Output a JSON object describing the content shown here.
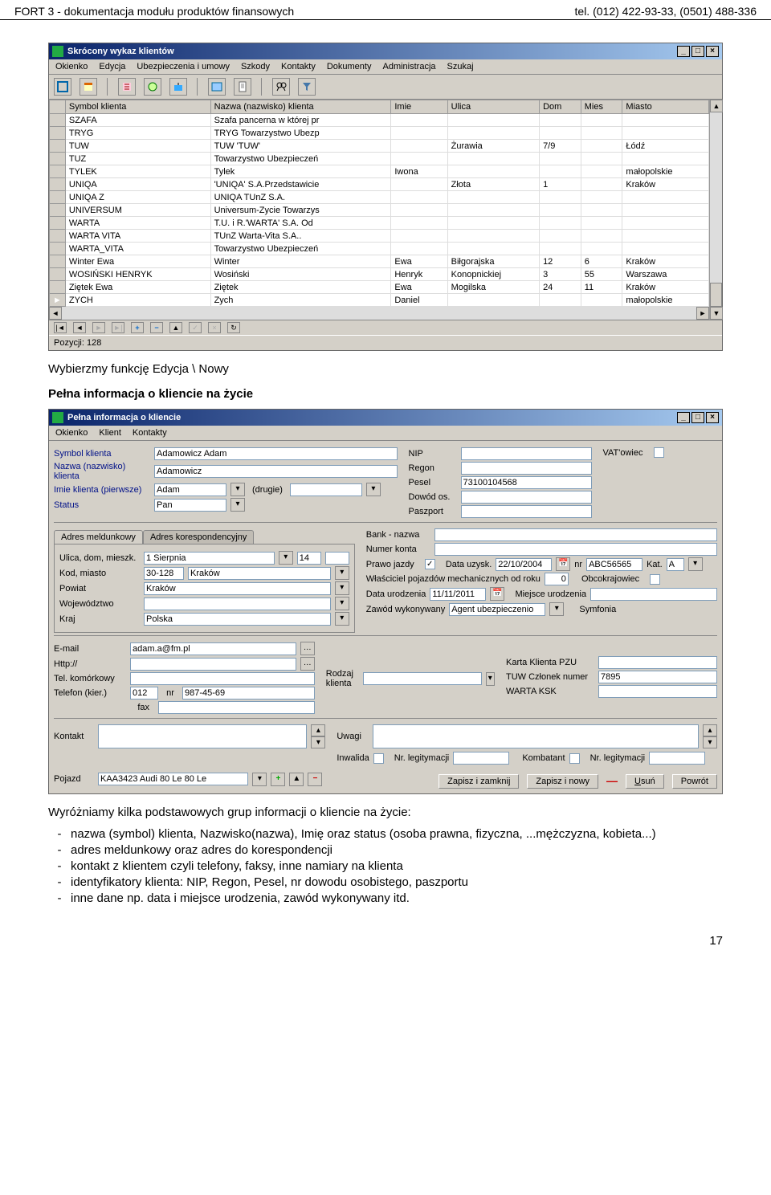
{
  "header": {
    "left": "FORT 3 - dokumentacja modułu produktów finansowych",
    "right": "tel. (012) 422-93-33, (0501) 488-336"
  },
  "win1": {
    "title": "Skrócony wykaz klientów",
    "menu": [
      "Okienko",
      "Edycja",
      "Ubezpieczenia i umowy",
      "Szkody",
      "Kontakty",
      "Dokumenty",
      "Administracja",
      "Szukaj"
    ],
    "cols": [
      "Symbol klienta",
      "Nazwa (nazwisko) klienta",
      "Imie",
      "Ulica",
      "Dom",
      "Mies",
      "Miasto"
    ],
    "rows": [
      [
        "SZAFA",
        "Szafa pancerna w której pr",
        "",
        "",
        "",
        "",
        ""
      ],
      [
        "TRYG",
        "TRYG Towarzystwo Ubezp",
        "",
        "",
        "",
        "",
        ""
      ],
      [
        "TUW",
        "TUW 'TUW'",
        "",
        "Żurawia",
        "7/9",
        "",
        "Łódź"
      ],
      [
        "TUZ",
        "Towarzystwo Ubezpieczeń",
        "",
        "",
        "",
        "",
        ""
      ],
      [
        "TYLEK",
        "Tylek",
        "Iwona",
        "",
        "",
        "",
        "małopolskie"
      ],
      [
        "UNIQA",
        "'UNIQA' S.A.Przedstawicie",
        "",
        "Złota",
        "1",
        "",
        "Kraków"
      ],
      [
        "UNIQA Z",
        "UNIQA TUnZ S.A.",
        "",
        "",
        "",
        "",
        ""
      ],
      [
        "UNIVERSUM",
        "Universum-Zycie Towarzys",
        "",
        "",
        "",
        "",
        ""
      ],
      [
        "WARTA",
        "T.U. i R.'WARTA' S.A. Od",
        "",
        "",
        "",
        "",
        ""
      ],
      [
        "WARTA VITA",
        "TUnZ Warta-Vita S.A..",
        "",
        "",
        "",
        "",
        ""
      ],
      [
        "WARTA_VITA",
        "Towarzystwo Ubezpieczeń",
        "",
        "",
        "",
        "",
        ""
      ],
      [
        "Winter Ewa",
        "Winter",
        "Ewa",
        "Biłgorajska",
        "12",
        "6",
        "Kraków"
      ],
      [
        "WOSIŃSKI HENRYK",
        "Wosiński",
        "Henryk",
        "Konopnickiej",
        "3",
        "55",
        "Warszawa"
      ],
      [
        "Ziętek Ewa",
        "Ziętek",
        "Ewa",
        "Mogilska",
        "24",
        "11",
        "Kraków"
      ],
      [
        "ZYCH",
        "Zych",
        "Daniel",
        "",
        "",
        "",
        "małopolskie"
      ]
    ],
    "status": "Pozycji: 128"
  },
  "para1": "Wybierzmy funkcję Edycja \\ Nowy",
  "para2": "Pełna informacja o kliencie na życie",
  "win2": {
    "title": "Pełna informacja o kliencie",
    "menu": [
      "Okienko",
      "Klient",
      "Kontakty"
    ],
    "labels": {
      "symbol": "Symbol klienta",
      "nazwa": "Nazwa (nazwisko) klienta",
      "imie1": "Imie klienta (pierwsze)",
      "drugie": "(drugie)",
      "status": "Status",
      "nip": "NIP",
      "regon": "Regon",
      "pesel": "Pesel",
      "dowod": "Dowód os.",
      "paszport": "Paszport",
      "vat": "VAT'owiec",
      "tab1": "Adres meldunkowy",
      "tab2": "Adres korespondencyjny",
      "ulica": "Ulica, dom, mieszk.",
      "kod": "Kod, miasto",
      "powiat": "Powiat",
      "woj": "Województwo",
      "kraj": "Kraj",
      "bank": "Bank - nazwa",
      "numer": "Numer konta",
      "prawo": "Prawo jazdy",
      "datau": "Data uzysk.",
      "nr": "nr",
      "kat": "Kat.",
      "wlasc": "Właściciel pojazdów mechanicznych od roku",
      "obco": "Obcokrajowiec",
      "datur": "Data urodzenia",
      "miejur": "Miejsce urodzenia",
      "zawod": "Zawód wykonywany",
      "symf": "Symfonia",
      "email": "E-mail",
      "http": "Http://",
      "telkom": "Tel. komórkowy",
      "telkier": "Telefon (kier.)",
      "nr2": "nr",
      "fax": "fax",
      "rodzaj": "Rodzaj klienta",
      "kpzu": "Karta Klienta PZU",
      "tuwn": "TUW Członek numer",
      "warta": "WARTA KSK",
      "kontakt": "Kontakt",
      "uwagi": "Uwagi",
      "inwalida": "Inwalida",
      "nleg1": "Nr. legitymacji",
      "kombat": "Kombatant",
      "nleg2": "Nr. legitymacji",
      "pojazd": "Pojazd"
    },
    "values": {
      "symbol": "Adamowicz Adam",
      "nazwa": "Adamowicz",
      "imie1": "Adam",
      "status": "Pan",
      "pesel": "73100104568",
      "ulica": "1 Sierpnia",
      "dom": "14",
      "kod": "30-128",
      "miasto": "Kraków",
      "powiat": "Kraków",
      "kraj": "Polska",
      "datau": "22/10/2004",
      "nrpj": "ABC56565",
      "kat": "A",
      "wlascrok": "0",
      "datur": "11/11/2011",
      "zawod": "Agent ubezpieczenio",
      "email": "adam.a@fm.pl",
      "telkier": "012",
      "telnr": "987-45-69",
      "tuwn": "7895",
      "pojazd": "KAA3423 Audi 80 Le 80 Le"
    },
    "buttons": {
      "zapzam": "Zapisz i zamknij",
      "zapnowy": "Zapisz i nowy",
      "usun": "Usuń",
      "powrot": "Powrót"
    }
  },
  "para3": "Wyróżniamy kilka podstawowych grup informacji o kliencie na życie:",
  "bullets": [
    "nazwa (symbol) klienta, Nazwisko(nazwa), Imię oraz status (osoba prawna, fizyczna, ...mężczyzna, kobieta...)",
    "adres meldunkowy oraz adres do korespondencji",
    "kontakt z klientem czyli telefony, faksy, inne namiary na klienta",
    "identyfikatory klienta: NIP, Regon, Pesel, nr dowodu osobistego, paszportu",
    "inne dane np. data i miejsce urodzenia, zawód wykonywany itd."
  ],
  "pageno": "17"
}
